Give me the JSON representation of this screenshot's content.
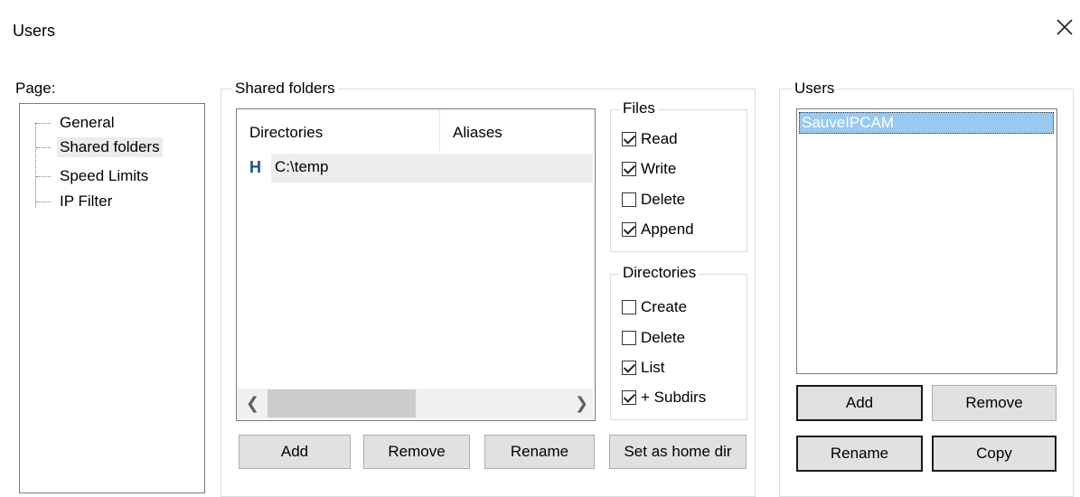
{
  "window": {
    "title": "Users"
  },
  "page_panel": {
    "label": "Page:",
    "items": [
      {
        "label": "General"
      },
      {
        "label": "Shared folders",
        "selected": true
      },
      {
        "label": "Speed Limits"
      },
      {
        "label": "IP Filter"
      }
    ]
  },
  "shared_folders": {
    "title": "Shared folders",
    "columns": [
      "Directories",
      "Aliases"
    ],
    "rows": [
      {
        "marker": "H",
        "directory": "C:\\temp",
        "alias": ""
      }
    ],
    "buttons": {
      "add": "Add",
      "remove": "Remove",
      "rename": "Rename",
      "set_home": "Set as home dir"
    }
  },
  "files": {
    "title": "Files",
    "options": [
      {
        "label": "Read",
        "checked": true
      },
      {
        "label": "Write",
        "checked": true
      },
      {
        "label": "Delete",
        "checked": false
      },
      {
        "label": "Append",
        "checked": true
      }
    ]
  },
  "directories": {
    "title": "Directories",
    "options": [
      {
        "label": "Create",
        "checked": false
      },
      {
        "label": "Delete",
        "checked": false
      },
      {
        "label": "List",
        "checked": true
      },
      {
        "label": "+ Subdirs",
        "checked": true
      }
    ]
  },
  "users": {
    "title": "Users",
    "list": [
      {
        "name": "SauveIPCAM",
        "selected": true
      }
    ],
    "buttons": {
      "add": "Add",
      "remove": "Remove",
      "rename": "Rename",
      "copy": "Copy"
    }
  }
}
